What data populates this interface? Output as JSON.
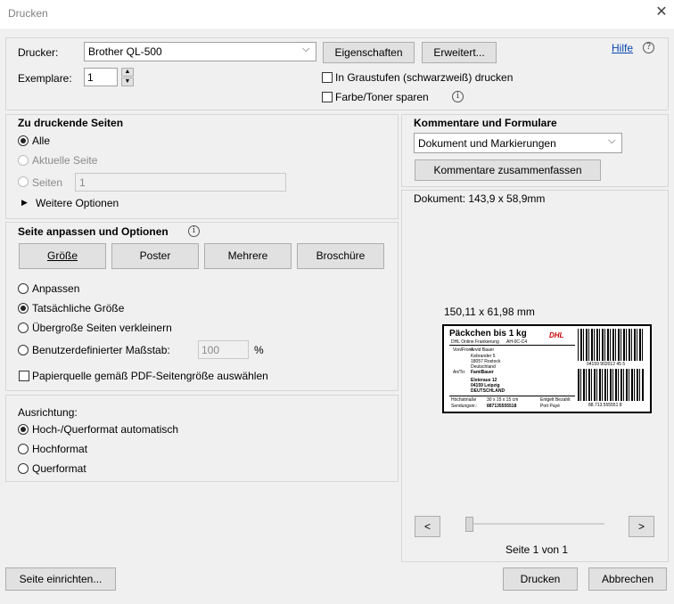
{
  "window": {
    "title": "Drucken"
  },
  "printer": {
    "label": "Drucker:",
    "selected": "Brother QL-500",
    "properties_button": "Eigenschaften",
    "advanced_button": "Erweitert...",
    "help_link": "Hilfe",
    "copies_label": "Exemplare:",
    "copies_value": "1",
    "grayscale_label": "In Graustufen (schwarzweiß) drucken",
    "save_toner_label": "Farbe/Toner sparen"
  },
  "pages": {
    "heading": "Zu druckende Seiten",
    "all": "Alle",
    "current": "Aktuelle Seite",
    "pages": "Seiten",
    "pages_value": "1",
    "more_options": "Weitere Optionen"
  },
  "sizing": {
    "heading": "Seite anpassen und Optionen",
    "tabs": [
      "Größe",
      "Poster",
      "Mehrere",
      "Broschüre"
    ],
    "fit": "Anpassen",
    "actual": "Tatsächliche Größe",
    "shrink": "Übergroße Seiten verkleinern",
    "custom": "Benutzerdefinierter Maßstab:",
    "custom_value": "100",
    "percent": "%",
    "paper_source": "Papierquelle gemäß PDF-Seitengröße auswählen"
  },
  "orientation": {
    "heading": "Ausrichtung:",
    "auto": "Hoch-/Querformat automatisch",
    "portrait": "Hochformat",
    "landscape": "Querformat"
  },
  "comments": {
    "heading": "Kommentare und Formulare",
    "selected": "Dokument und Markierungen",
    "summarize_button": "Kommentare zusammenfassen"
  },
  "preview": {
    "document_size": "Dokument: 143,9 x 58,9mm",
    "paper_size": "150,11 x 61,98 mm",
    "prev": "<",
    "next": ">",
    "page_indicator": "Seite 1 von 1",
    "slider_position": 0
  },
  "label": {
    "title": "Päckchen bis 1 kg",
    "logo": "DHL",
    "service": "DHL Online Frankierung",
    "code1": "AH-0C-C4",
    "from_label": "Von/From:",
    "from_name": "Arvid Bauer",
    "sender_street": "Kebrander 5",
    "sender_city": "18057 Rostock",
    "sender_country": "Deutschland",
    "to_label": "An/To:",
    "to_name": "FamiBauer",
    "to_street": "Elsteraue 12",
    "to_city": "04159 Leipzig",
    "to_country": "DEUTSCHLAND",
    "dims_label": "Höchstmaße",
    "dims_value": "30 x 15 x 15 cm",
    "shipment_label": "Sendungsnr.:",
    "shipment_value": "887135555518",
    "postage": "Entgelt Bezahlt",
    "postage2": "Port Payé",
    "barcode1_text": "04159 902012 45 5",
    "barcode2_text": "88.713.555551 8"
  },
  "footer": {
    "page_setup_button": "Seite einrichten...",
    "print_button": "Drucken",
    "cancel_button": "Abbrechen"
  }
}
